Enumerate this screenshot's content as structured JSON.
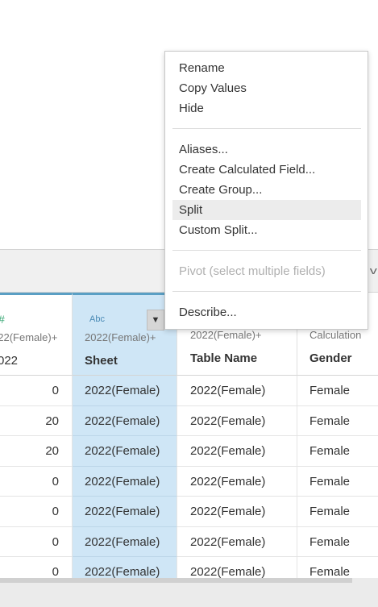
{
  "colors": {
    "accent": "#5a9fc4",
    "selected_column": "#cfe6f6",
    "number_icon": "#3aa876",
    "string_icon": "#4a8ab5"
  },
  "grid": {
    "columns": [
      {
        "icon": "#",
        "icon_name": "number-icon",
        "origin": "022(Female)+",
        "name": "022"
      },
      {
        "icon": "Abc",
        "icon_name": "string-icon",
        "origin": "2022(Female)+",
        "name": "Sheet"
      },
      {
        "icon": "",
        "icon_name": "",
        "origin": "2022(Female)+",
        "name": "Table Name"
      },
      {
        "icon": "",
        "icon_name": "",
        "origin": "Calculation",
        "name": "Gender"
      }
    ],
    "rows": [
      [
        "0",
        "2022(Female)",
        "2022(Female)",
        "Female"
      ],
      [
        "20",
        "2022(Female)",
        "2022(Female)",
        "Female"
      ],
      [
        "20",
        "2022(Female)",
        "2022(Female)",
        "Female"
      ],
      [
        "0",
        "2022(Female)",
        "2022(Female)",
        "Female"
      ],
      [
        "0",
        "2022(Female)",
        "2022(Female)",
        "Female"
      ],
      [
        "0",
        "2022(Female)",
        "2022(Female)",
        "Female"
      ],
      [
        "0",
        "2022(Female)",
        "2022(Female)",
        "Female"
      ]
    ]
  },
  "menu": {
    "rename": "Rename",
    "copy_values": "Copy Values",
    "hide": "Hide",
    "aliases": "Aliases...",
    "create_calculated_field": "Create Calculated Field...",
    "create_group": "Create Group...",
    "split": "Split",
    "custom_split": "Custom Split...",
    "pivot": "Pivot (select multiple fields)",
    "describe": "Describe..."
  },
  "icons": {
    "dropdown": "▼",
    "band_chevron": "v"
  }
}
